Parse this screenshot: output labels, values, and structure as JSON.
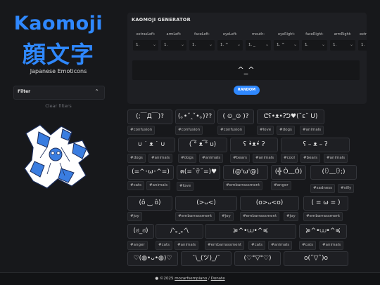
{
  "sidebar": {
    "logo_en": "Kaomoji",
    "logo_jp": "顔文字",
    "tagline": "Japanese Emoticons",
    "filter_label": "Filter",
    "clear_filters": "Clear filters"
  },
  "generator": {
    "title": "KAOMOJI GENERATOR",
    "fields": [
      {
        "label": "extrasLeft:",
        "value": "1."
      },
      {
        "label": "armLeft:",
        "value": "1."
      },
      {
        "label": "faceLeft:",
        "value": "1."
      },
      {
        "label": "eyeLeft:",
        "value": "1. ^"
      },
      {
        "label": "mouth:",
        "value": "1. _"
      },
      {
        "label": "eyeRight:",
        "value": "1. ^"
      },
      {
        "label": "faceRight:",
        "value": "1."
      },
      {
        "label": "armRight:",
        "value": "1."
      },
      {
        "label": "extr",
        "value": "1."
      }
    ],
    "preview": "^_^",
    "random_label": "RANDOM"
  },
  "rows": [
    {
      "cards": [
        {
          "text": "(;￣Д￣)?"
        },
        {
          "text": "(｡•ˇ‸ˇ•｡)??"
        },
        {
          "text": "( ⊙_⊙ )?"
        },
        {
          "text": "ᕦʕ•ᴥ•ʔᕤ♥(˘ε˘ U)"
        }
      ],
      "tags": [
        "#confusion",
        "#confusion",
        "#confusion",
        "#love",
        "#dogs",
        "#animals"
      ]
    },
    {
      "cards": [
        {
          "text": "∪ ˙ ᴥ ˙ ∪"
        },
        {
          "text": "( ͡° ᴥ ͡° ʋ)"
        },
        {
          "text": "ʕ •̀ᴥ•́ ʔ"
        },
        {
          "text": "ʕ – ᴥ – ʔ"
        }
      ],
      "tags": [
        "#dogs",
        "#animals",
        "#dogs",
        "#animals",
        "#bears",
        "#animals",
        "#cool",
        "#bears",
        "#animals"
      ]
    },
    {
      "cards": [
        {
          "text": "(=^･ω･^=)"
        },
        {
          "text": "ฅ(=˘ꈊ˘=)♥"
        },
        {
          "text": "(@'ω'@)"
        },
        {
          "text": "(╬ Ò﹏Ó)"
        },
        {
          "text": "(ꏿ﹏ꏿ;)"
        }
      ],
      "tags": [
        "#cats",
        "#animals",
        "#love",
        "#embarrassment",
        "#anger",
        "#sadness",
        "#silly"
      ]
    },
    {
      "cards": [
        {
          "text": "(ô ‿ ô)"
        },
        {
          "text": "(>ᴗ<)"
        },
        {
          "text": "(o>ᴗ<o)"
        },
        {
          "text": "( = ω = )"
        }
      ],
      "tags": [
        "#joy",
        "#embarrassment",
        "#joy",
        "#embarrassment",
        "#joy",
        "#embarrassment"
      ]
    },
    {
      "cards": [
        {
          "text": "(ಠ_ಠ)"
        },
        {
          "text": "/ᐠ｡ꞈ｡ᐟ\\"
        },
        {
          "text": "≽^•⩊•^≼"
        },
        {
          "text": "≽^•⩊•^≼"
        }
      ],
      "tags": [
        "#anger",
        "#cats",
        "#animals",
        "#embarrassment",
        "#cats",
        "#animals",
        "#cats",
        "#animals"
      ]
    },
    {
      "cards": [
        {
          "text": "♡(◍•ᴗ•◍)♡"
        },
        {
          "text": "¯\\_(ツ)_/¯"
        },
        {
          "text": "(♡°▽°♡)"
        },
        {
          "text": "o(ˆ▽ˆ)o"
        }
      ],
      "tags": []
    }
  ],
  "footer": {
    "copyright": "©2025",
    "author": "mozarfsempiano",
    "separator": "/",
    "donate": "Donate"
  },
  "colors": {
    "accent": "#2f88ff",
    "background": "#17181b",
    "panel": "#1e1f23"
  }
}
